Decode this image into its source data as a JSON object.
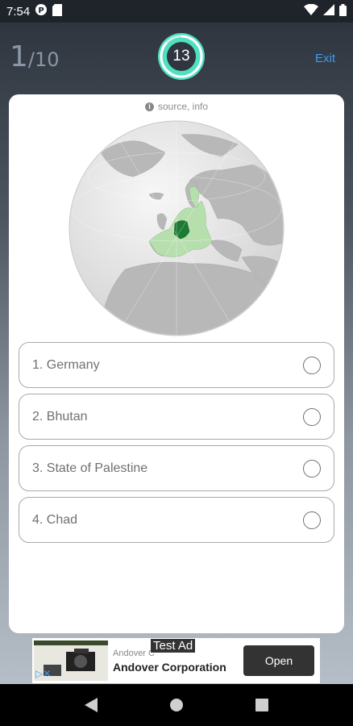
{
  "status_bar": {
    "time": "7:54",
    "icons": [
      "p-circle-icon",
      "sd-card-icon",
      "wifi-icon",
      "signal-icon",
      "battery-icon"
    ]
  },
  "header": {
    "question_current": "1",
    "question_total": "/10",
    "timer": "13",
    "timer_fraction_remaining": 0.87,
    "exit_label": "Exit",
    "colors": {
      "accent": "#4fe0c0",
      "counter": "#8a97a6",
      "exit": "#3b9cf0"
    }
  },
  "card": {
    "source_label": "source, info",
    "globe_highlight_country": "Germany",
    "options": [
      {
        "label": "1. Germany"
      },
      {
        "label": "2. Bhutan"
      },
      {
        "label": "3. State of Palestine"
      },
      {
        "label": "4. Chad"
      }
    ]
  },
  "ad": {
    "badge": "Test Ad",
    "advertiser": "Andover C",
    "title": "Andover Corporation",
    "cta": "Open"
  },
  "nav": {
    "buttons": [
      "back-icon",
      "home-icon",
      "recents-icon"
    ]
  }
}
